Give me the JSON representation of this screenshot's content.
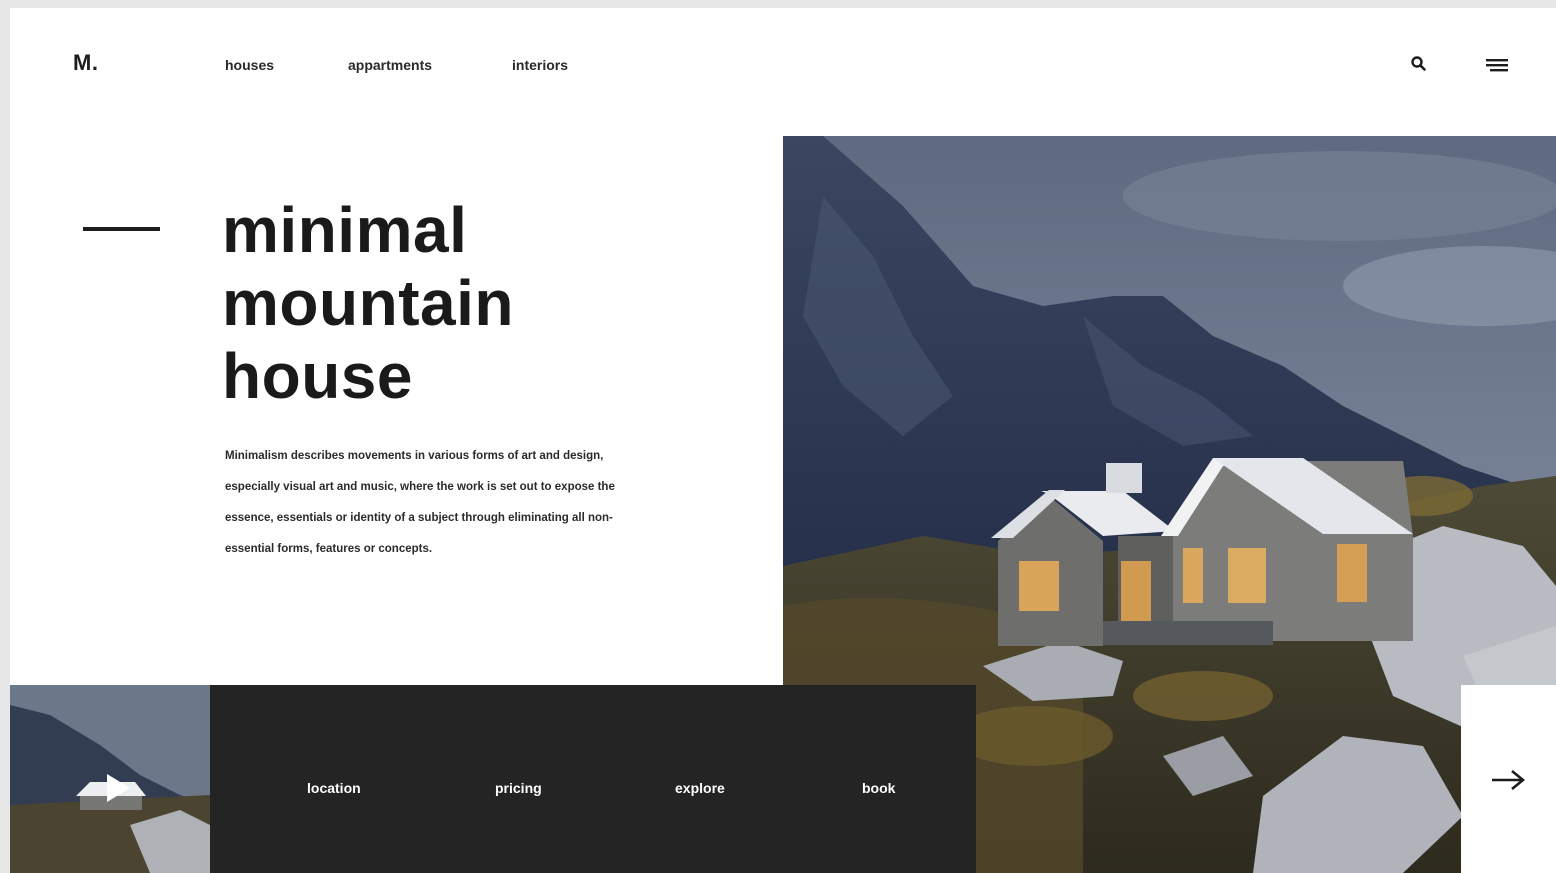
{
  "header": {
    "logo": "M.",
    "nav": [
      {
        "label": "houses"
      },
      {
        "label": "appartments"
      },
      {
        "label": "interiors"
      }
    ],
    "search_icon": "search-icon",
    "menu_icon": "hamburger-menu-icon"
  },
  "hero": {
    "title_lines": [
      "minimal",
      "mountain",
      "house"
    ],
    "description": "Minimalism describes movements in various forms of art and design, especially visual art and music, where the work is set out to expose the essence, essentials or identity of a subject through eliminating all non-essential forms, features or concepts."
  },
  "bottom_bar": {
    "links": [
      {
        "label": "location"
      },
      {
        "label": "pricing"
      },
      {
        "label": "explore"
      },
      {
        "label": "book"
      }
    ],
    "play_icon": "play-icon",
    "next_icon": "arrow-right-icon"
  },
  "colors": {
    "text": "#1c1c1c",
    "bar": "#242424",
    "background": "#ffffff"
  }
}
